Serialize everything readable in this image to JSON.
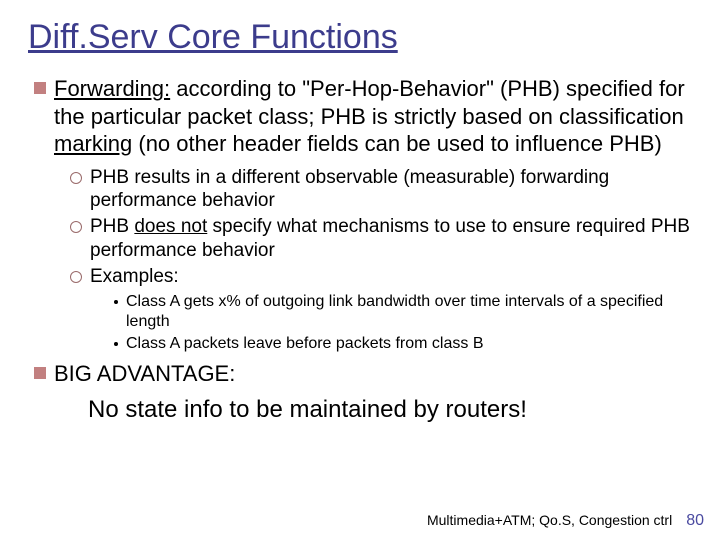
{
  "title": "Diff.Serv Core Functions",
  "bullets": {
    "b1": {
      "lead": "Forwarding:",
      "rest1": " according to \"Per-Hop-Behavior\" (PHP) specified for the particular packet class; ",
      "rest_full": " according to \"Per-Hop-Behavior\" (PHB) specified for the particular packet class; PHB is strictly based on classification ",
      "marking": "marking",
      "tail": " (no other header fields can be used to influence PHB)"
    },
    "sub": {
      "s1": "PHB results in a different observable (measurable) forwarding performance behavior",
      "s2a": "PHB ",
      "s2b": "does not",
      "s2c": " specify what mechanisms to use to ensure required PHB performance behavior",
      "s3": "Examples:"
    },
    "ex": {
      "e1": "Class A gets x% of outgoing link bandwidth over time intervals of a specified length",
      "e2": "Class A packets leave before packets from class B"
    },
    "b2": {
      "lead": "BIG ADVANTAGE:",
      "line": "No state info to be maintained by routers!"
    }
  },
  "footer": {
    "text": "Multimedia+ATM; Qo.S, Congestion ctrl",
    "page": "80"
  }
}
